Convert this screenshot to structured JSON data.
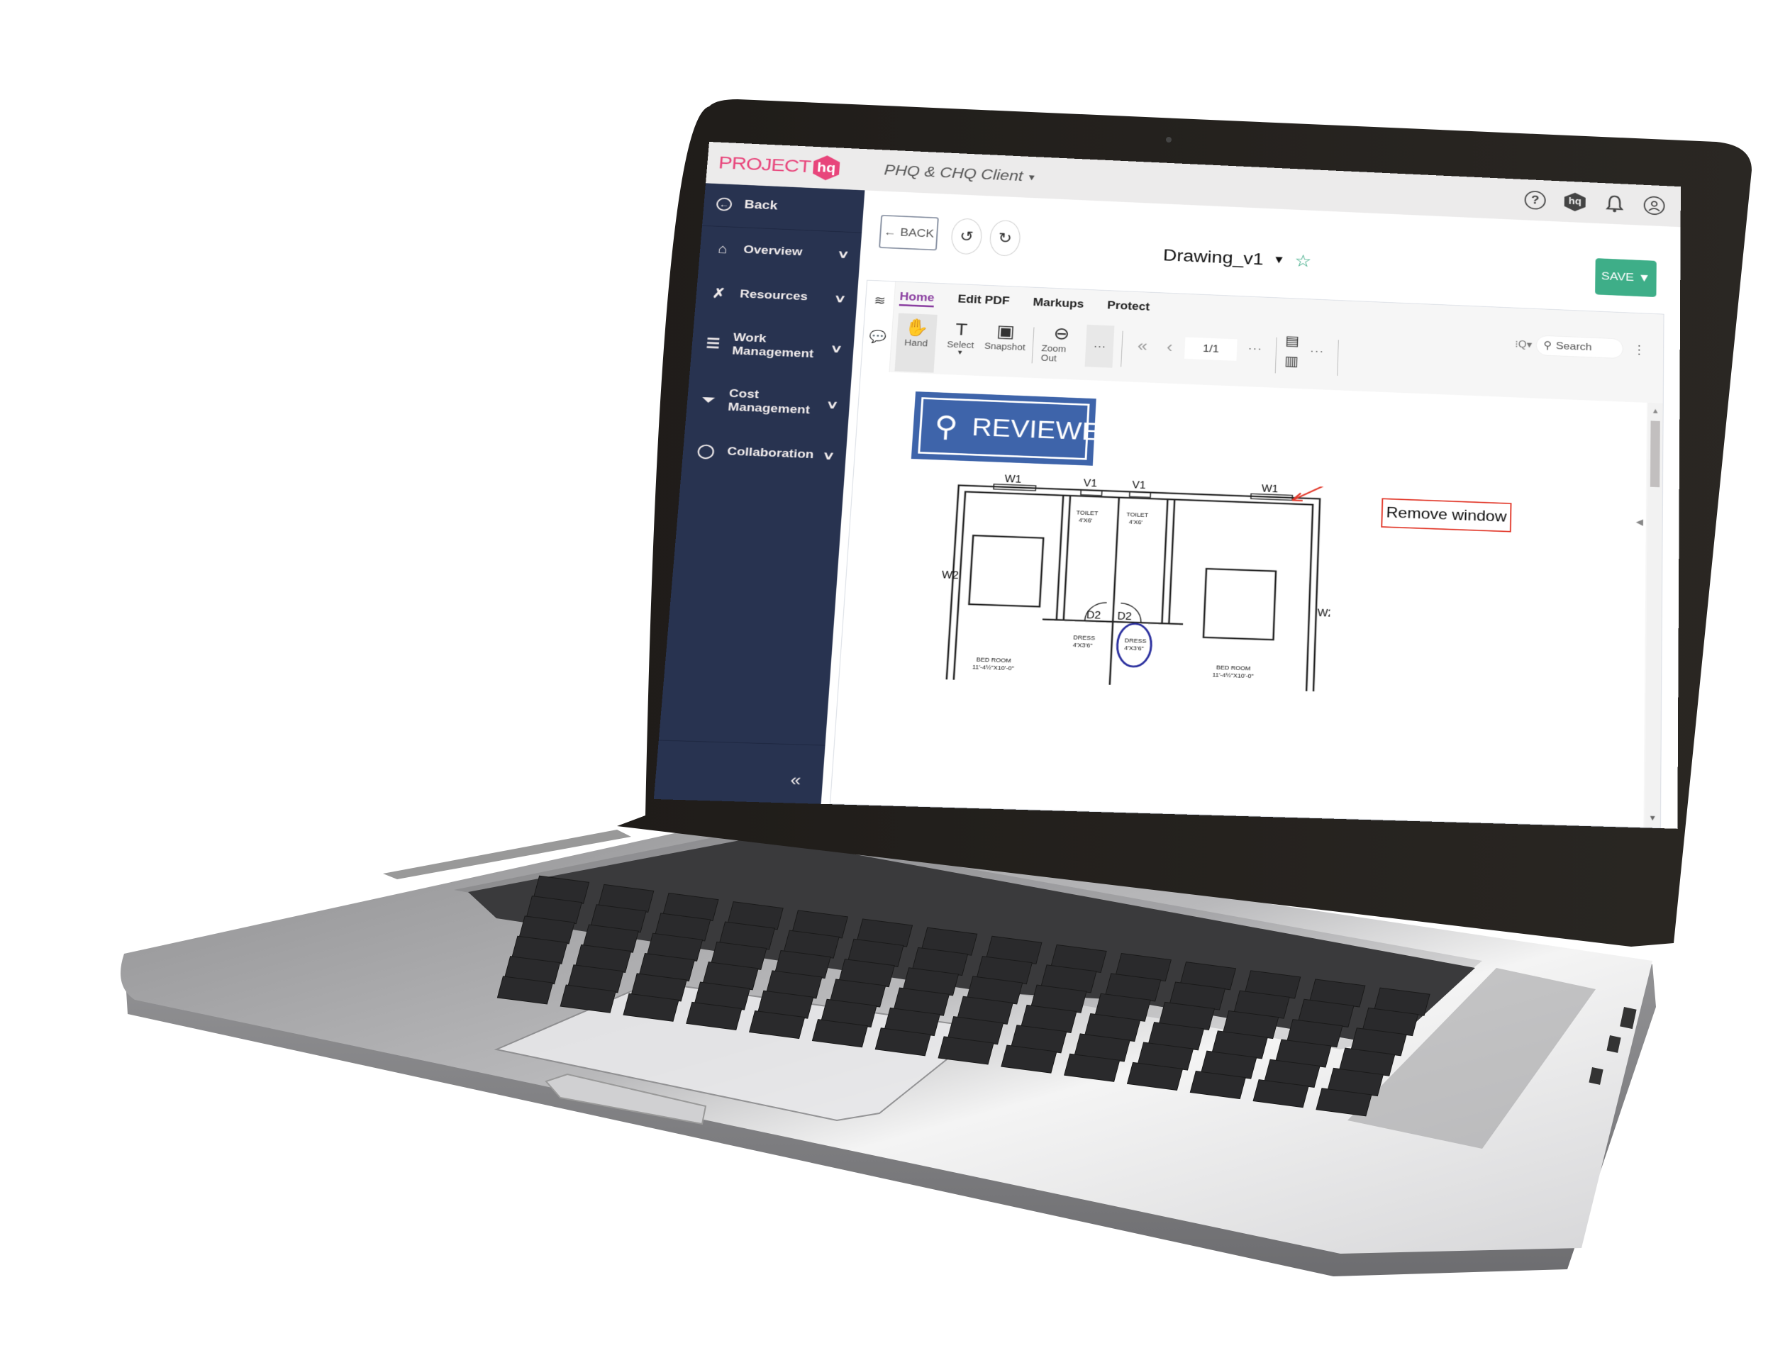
{
  "app": {
    "logo_text": "PROJECT",
    "logo_badge": "hq",
    "client_selector": "PHQ & CHQ Client",
    "top_icons": [
      {
        "name": "help-icon",
        "glyph": "?"
      },
      {
        "name": "hq-brand-icon",
        "glyph": "hq"
      },
      {
        "name": "notification-bell-icon",
        "glyph": "🔔"
      },
      {
        "name": "user-profile-icon",
        "glyph": "👤"
      }
    ]
  },
  "sidebar": {
    "back_label": "Back",
    "items": [
      {
        "label": "Overview",
        "icon": "home-icon",
        "glyph": "⌂"
      },
      {
        "label": "Resources",
        "icon": "tools-icon",
        "glyph": "✗"
      },
      {
        "label": "Work Management",
        "icon": "checklist-icon",
        "glyph": "☰"
      },
      {
        "label": "Cost Management",
        "icon": "cost-funnel-icon",
        "glyph": "⏷"
      },
      {
        "label": "Collaboration",
        "icon": "chat-bubble-icon",
        "glyph": "◯"
      }
    ],
    "collapse_glyph": "«"
  },
  "header": {
    "back_button": "BACK",
    "undo_glyph": "↺",
    "redo_glyph": "↻",
    "document_title": "Drawing_v1",
    "save_button": "SAVE"
  },
  "viewer": {
    "tabs": [
      {
        "label": "Home",
        "active": true
      },
      {
        "label": "Edit PDF",
        "active": false
      },
      {
        "label": "Markups",
        "active": false
      },
      {
        "label": "Protect",
        "active": false
      }
    ],
    "tools": [
      {
        "label": "Hand",
        "glyph": "✋",
        "active": true
      },
      {
        "label": "Select",
        "glyph": "T",
        "active": false
      },
      {
        "label": "Snapshot",
        "glyph": "▣",
        "active": false
      },
      {
        "label": "Zoom Out",
        "glyph": "⊖",
        "active": false
      }
    ],
    "more_glyph": "···",
    "first_page_glyph": "«",
    "prev_page_glyph": "‹",
    "page_indicator": "1/1",
    "search_placeholder": "Search"
  },
  "document": {
    "stamp_text": "REVIEWED",
    "callout_text": "Remove window",
    "floorplan_labels": {
      "w1": "W1",
      "v1": "V1",
      "w2": "W2",
      "d2": "D2",
      "toilet": "TOILET",
      "toilet_size": "4'X6'",
      "dress": "DRESS",
      "dress_size": "4'X3'6\"",
      "bedroom": "BED ROOM",
      "bedroom_size": "11'-4½\"X10'-0\""
    }
  },
  "colors": {
    "brand_pink": "#e8457b",
    "sidebar_navy": "#283350",
    "save_green": "#3eae88",
    "active_tab_purple": "#8a3ea0",
    "stamp_blue": "#3e64aa",
    "callout_red": "#e23b2d",
    "markup_circle_blue": "#2a2f9e"
  }
}
